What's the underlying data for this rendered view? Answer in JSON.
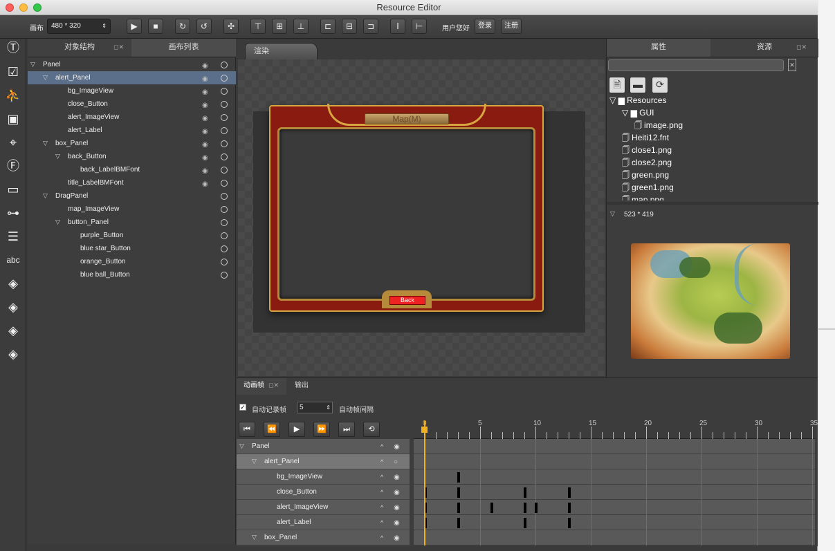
{
  "window": {
    "title": "Resource Editor"
  },
  "toolbar": {
    "canvas_label": "画布",
    "size_value": "480 * 320",
    "greeting": "用户您好",
    "login": "登录",
    "register": "注册"
  },
  "tree_panel": {
    "tab_object_structure": "对象结构",
    "tab_canvas_list": "画布列表",
    "rows": [
      {
        "label": "Panel",
        "level": 0,
        "expand": true
      },
      {
        "label": "alert_Panel",
        "level": 1,
        "expand": true,
        "selected": true
      },
      {
        "label": "bg_ImageView",
        "level": 2
      },
      {
        "label": "close_Button",
        "level": 2
      },
      {
        "label": "alert_ImageView",
        "level": 2
      },
      {
        "label": "alert_Label",
        "level": 2
      },
      {
        "label": "box_Panel",
        "level": 1,
        "expand": true
      },
      {
        "label": "back_Button",
        "level": 2,
        "expand": true
      },
      {
        "label": "back_LabelBMFont",
        "level": 3
      },
      {
        "label": "title_LabelBMFont",
        "level": 2
      },
      {
        "label": "DragPanel",
        "level": 1,
        "expand": true
      },
      {
        "label": "map_ImageView",
        "level": 2
      },
      {
        "label": "button_Panel",
        "level": 2,
        "expand": true
      },
      {
        "label": "purple_Button",
        "level": 3
      },
      {
        "label": "blue star_Button",
        "level": 3
      },
      {
        "label": "orange_Button",
        "level": 3
      },
      {
        "label": "blue ball_Button",
        "level": 3
      }
    ]
  },
  "render": {
    "tab_label": "渲染",
    "map_title": "Map(M)",
    "back_label": "Back"
  },
  "right_panel": {
    "tab_properties": "属性",
    "tab_resources": "资源",
    "tree": [
      {
        "label": "Resources",
        "type": "folder",
        "level": 0
      },
      {
        "label": "GUI",
        "type": "folder",
        "level": 1
      },
      {
        "label": "image.png",
        "type": "file",
        "level": 2
      },
      {
        "label": "Heiti12.fnt",
        "type": "file",
        "level": 1
      },
      {
        "label": "close1.png",
        "type": "file",
        "level": 1
      },
      {
        "label": "close2.png",
        "type": "file",
        "level": 1
      },
      {
        "label": "green.png",
        "type": "file",
        "level": 1
      },
      {
        "label": "green1.png",
        "type": "file",
        "level": 1
      },
      {
        "label": "map.png",
        "type": "file",
        "level": 1
      }
    ],
    "preview_size": "523 * 419"
  },
  "timeline": {
    "tab_animation": "动画帧",
    "tab_output": "输出",
    "auto_record_label": "自动记录帧",
    "auto_record_checked": true,
    "interval_value": "5",
    "interval_label": "自动帧间隔",
    "ruler": [
      "0",
      "5",
      "10",
      "15",
      "20",
      "25",
      "30",
      "35"
    ],
    "tracks": [
      {
        "label": "Panel",
        "level": 0,
        "expand": true,
        "keyframes": []
      },
      {
        "label": "alert_Panel",
        "level": 1,
        "expand": true,
        "selected": true,
        "keyframes": []
      },
      {
        "label": "bg_ImageView",
        "level": 2,
        "keyframes": [
          3
        ]
      },
      {
        "label": "close_Button",
        "level": 2,
        "keyframes": [
          0,
          3,
          9,
          13
        ]
      },
      {
        "label": "alert_ImageView",
        "level": 2,
        "keyframes": [
          0,
          3,
          6,
          9,
          10,
          13
        ]
      },
      {
        "label": "alert_Label",
        "level": 2,
        "keyframes": [
          0,
          3,
          9,
          13
        ]
      },
      {
        "label": "box_Panel",
        "level": 1,
        "expand": true,
        "keyframes": []
      }
    ]
  },
  "colors": {
    "accent": "#f0b020",
    "panel_red": "#8a1b10",
    "gold": "#d8a640"
  }
}
